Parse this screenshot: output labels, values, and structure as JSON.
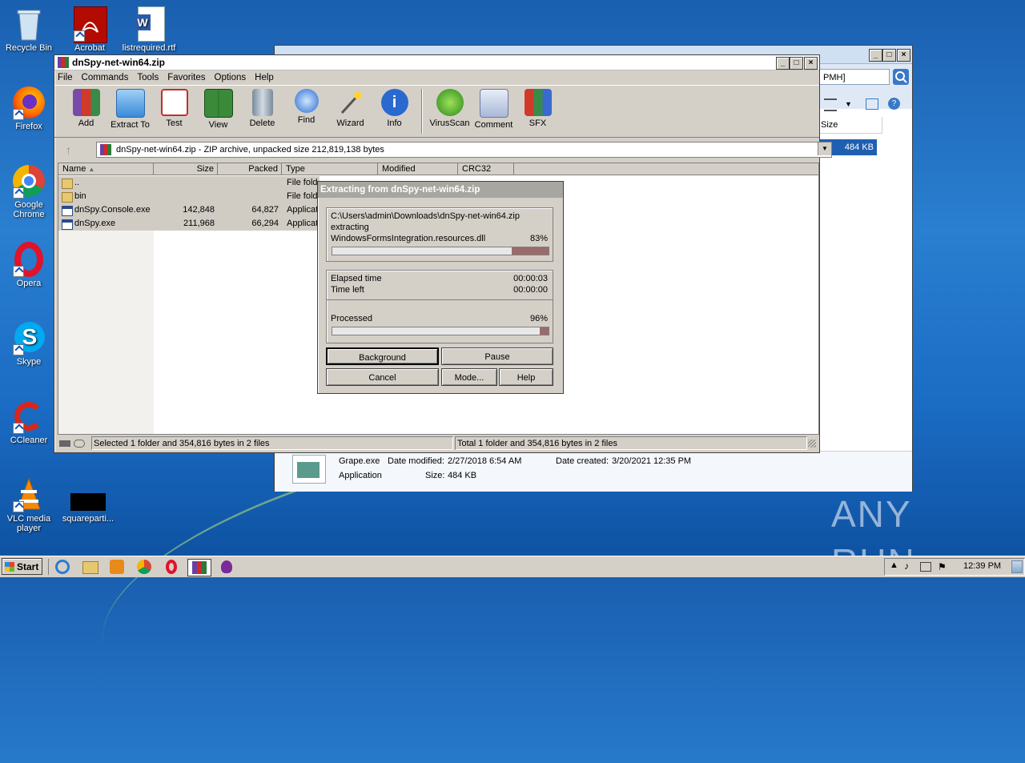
{
  "desktop": {
    "icons": [
      {
        "label": "Recycle Bin"
      },
      {
        "label": "Acrobat"
      },
      {
        "label": "listrequired.rtf"
      },
      {
        "label": "Firefox"
      },
      {
        "label": "Google Chrome"
      },
      {
        "label": "Opera"
      },
      {
        "label": "Skype"
      },
      {
        "label": "CCleaner"
      },
      {
        "label": "VLC media player"
      },
      {
        "label": "squareparti..."
      }
    ],
    "watermark": "ANY RUN"
  },
  "explorer": {
    "search_text": "PMH]",
    "size_header": "Size",
    "size_value": "484 KB",
    "details": {
      "name": "Grape.exe",
      "modified_label": "Date modified:",
      "modified": "2/27/2018 6:54 AM",
      "created_label": "Date created:",
      "created": "3/20/2021 12:35 PM",
      "type": "Application",
      "size_label": "Size:",
      "size": "484 KB"
    }
  },
  "winrar": {
    "title": "dnSpy-net-win64.zip",
    "menu": [
      "File",
      "Commands",
      "Tools",
      "Favorites",
      "Options",
      "Help"
    ],
    "toolbar": [
      {
        "label": "Add",
        "icon": "add-icon"
      },
      {
        "label": "Extract To",
        "icon": "extract-to-icon"
      },
      {
        "label": "Test",
        "icon": "test-icon"
      },
      {
        "label": "View",
        "icon": "view-icon"
      },
      {
        "label": "Delete",
        "icon": "delete-icon"
      },
      {
        "label": "Find",
        "icon": "find-icon"
      },
      {
        "label": "Wizard",
        "icon": "wizard-icon"
      },
      {
        "label": "Info",
        "icon": "info-icon"
      },
      {
        "label": "VirusScan",
        "icon": "virusscan-icon"
      },
      {
        "label": "Comment",
        "icon": "comment-icon"
      },
      {
        "label": "SFX",
        "icon": "sfx-icon"
      }
    ],
    "address": "dnSpy-net-win64.zip - ZIP archive, unpacked size 212,819,138 bytes",
    "columns": [
      "Name",
      "Size",
      "Packed",
      "Type",
      "Modified",
      "CRC32"
    ],
    "rows": [
      {
        "name": "..",
        "size": "",
        "packed": "",
        "type": "File fold"
      },
      {
        "name": "bin",
        "size": "",
        "packed": "",
        "type": "File fold"
      },
      {
        "name": "dnSpy.Console.exe",
        "size": "142,848",
        "packed": "64,827",
        "type": "Applicat"
      },
      {
        "name": "dnSpy.exe",
        "size": "211,968",
        "packed": "66,294",
        "type": "Applicat"
      }
    ],
    "status_left": "Selected 1 folder and 354,816 bytes in 2 files",
    "status_right": "Total 1 folder and 354,816 bytes in 2 files"
  },
  "extract_dialog": {
    "title": "Extracting from dnSpy-net-win64.zip",
    "path": "C:\\Users\\admin\\Downloads\\dnSpy-net-win64.zip",
    "action": "extracting",
    "file": "WindowsFormsIntegration.resources.dll",
    "file_percent": "83%",
    "file_progress": 0.83,
    "elapsed_label": "Elapsed time",
    "elapsed": "00:00:03",
    "left_label": "Time left",
    "left": "00:00:00",
    "processed_label": "Processed",
    "processed_percent": "96%",
    "processed_progress": 0.96,
    "buttons": {
      "background": "Background",
      "pause": "Pause",
      "cancel": "Cancel",
      "mode": "Mode...",
      "help": "Help"
    }
  },
  "taskbar": {
    "start": "Start",
    "clock": "12:39 PM"
  }
}
